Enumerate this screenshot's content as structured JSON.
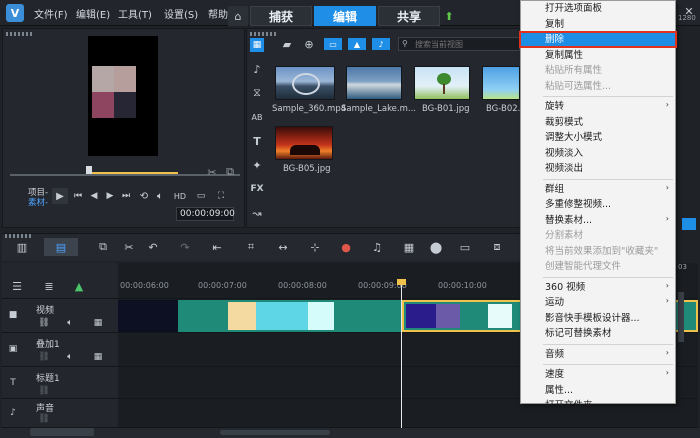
{
  "menubar": {
    "logo": "V",
    "items": [
      "文件(F)",
      "编辑(E)",
      "工具(T)",
      "设置(S)",
      "帮助"
    ],
    "tabs": [
      "捕获",
      "编辑",
      "共享"
    ],
    "active_tab": "编辑"
  },
  "player": {
    "labels": [
      "项目-",
      "素材-"
    ],
    "timecode": "00:00:09:00"
  },
  "library": {
    "search_placeholder": "搜索当前视图",
    "items": [
      {
        "label": "Sample_360.mp4"
      },
      {
        "label": "Sample_Lake.m..."
      },
      {
        "label": "BG-B01.jpg"
      },
      {
        "label": "BG-B02..."
      },
      {
        "label": "BG-B05.jpg"
      }
    ]
  },
  "timeline": {
    "ruler": [
      "00:00:06:00",
      "00:00:07:00",
      "00:00:08:00",
      "00:00:09:00",
      "00:00:10:00"
    ],
    "tracks": [
      {
        "name": "视频"
      },
      {
        "name": "叠加1"
      },
      {
        "name": "标题1"
      },
      {
        "name": "声音"
      }
    ],
    "right_values": [
      "03",
      "1280"
    ]
  },
  "context_menu": {
    "items": [
      {
        "label": "打开选项面板",
        "state": "normal",
        "submenu": false
      },
      {
        "label": "复制",
        "state": "normal",
        "submenu": false
      },
      {
        "label": "删除",
        "state": "highlighted",
        "submenu": false
      },
      {
        "label": "复制属性",
        "state": "normal",
        "submenu": false
      },
      {
        "label": "粘贴所有属性",
        "state": "disabled",
        "submenu": false
      },
      {
        "label": "粘贴可选属性...",
        "state": "disabled",
        "submenu": false
      },
      {
        "label": "旋转",
        "state": "normal",
        "submenu": true
      },
      {
        "label": "裁剪模式",
        "state": "normal",
        "submenu": false
      },
      {
        "label": "调整大小模式",
        "state": "normal",
        "submenu": false
      },
      {
        "label": "视频淡入",
        "state": "normal",
        "submenu": false
      },
      {
        "label": "视频淡出",
        "state": "normal",
        "submenu": false
      },
      {
        "label": "群组",
        "state": "normal",
        "submenu": true
      },
      {
        "label": "多重修整视频...",
        "state": "normal",
        "submenu": false
      },
      {
        "label": "替换素材...",
        "state": "normal",
        "submenu": true
      },
      {
        "label": "分割素材",
        "state": "disabled",
        "submenu": false
      },
      {
        "label": "将当前效果添加到\"收藏夹\"",
        "state": "disabled",
        "submenu": false
      },
      {
        "label": "创建智能代理文件",
        "state": "disabled",
        "submenu": false
      },
      {
        "label": "360 视频",
        "state": "normal",
        "submenu": true
      },
      {
        "label": "运动",
        "state": "normal",
        "submenu": true
      },
      {
        "label": "影音快手模板设计器...",
        "state": "normal",
        "submenu": false
      },
      {
        "label": "标记可替换素材",
        "state": "normal",
        "submenu": false
      },
      {
        "label": "音频",
        "state": "normal",
        "submenu": true
      },
      {
        "label": "速度",
        "state": "normal",
        "submenu": true
      },
      {
        "label": "属性...",
        "state": "normal",
        "submenu": false
      },
      {
        "label": "打开文件夹...",
        "state": "normal",
        "submenu": false
      }
    ]
  },
  "colors": {
    "accent": "#1f8ee6",
    "highlight_outline": "#e0311c",
    "clip_teal": "#1f8a78"
  }
}
